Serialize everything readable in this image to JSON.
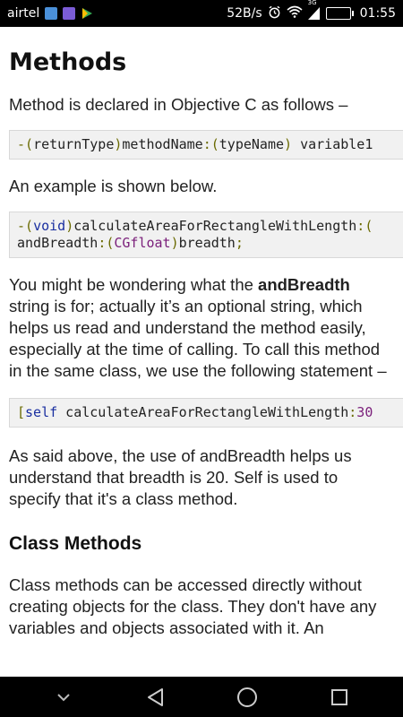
{
  "status_bar": {
    "carrier": "airtel",
    "speed": "52B/s",
    "network": "3G",
    "battery": "39",
    "time": "01:55",
    "colors": {
      "background": "#000000",
      "battery_fill": "#7ed321"
    }
  },
  "article": {
    "title": "Methods",
    "p1": "Method is declared in Objective C as follows –",
    "code1": {
      "t1": "-(",
      "t2": "returnType",
      "t3": ")",
      "t4": "methodName",
      "t5": ":(",
      "t6": "typeName",
      "t7": ")",
      "t8": " variable1"
    },
    "p2": "An example is shown below.",
    "code2": {
      "l1_t1": "-(",
      "l1_t2": "void",
      "l1_t3": ")",
      "l1_t4": "calculateAreaForRectangleWithLength",
      "l1_t5": ":(",
      "l2_t1": "andBreadth",
      "l2_t2": ":(",
      "l2_t3": "CGfloat",
      "l2_t4": ")",
      "l2_t5": "breadth",
      "l2_t6": ";"
    },
    "p3_before": "You might be wondering what the ",
    "p3_bold": "andBreadth",
    "p3_after": " string is for; actually it’s an optional string, which helps us read and understand the method easily, especially at the time of calling. To call this method in the same class, we use the following statement –",
    "code3": {
      "t1": "[",
      "t2": "self",
      "t3": " calculateAreaForRectangleWithLength",
      "t4": ":",
      "t5": "30"
    },
    "p4": "As said above, the use of andBreadth helps us understand that breadth is 20. Self is used to specify that it's a class method.",
    "section_title": "Class Methods",
    "p5": "Class methods can be accessed directly without creating objects for the class. They don't have any variables and objects associated with it. An"
  },
  "icons": {
    "notifications": [
      "mail-icon",
      "gallery-icon",
      "play-store-icon"
    ],
    "status": [
      "alarm-icon",
      "wifi-icon",
      "signal-icon",
      "battery-icon"
    ],
    "nav": [
      "collapse-icon",
      "back-icon",
      "home-icon",
      "recents-icon"
    ]
  }
}
